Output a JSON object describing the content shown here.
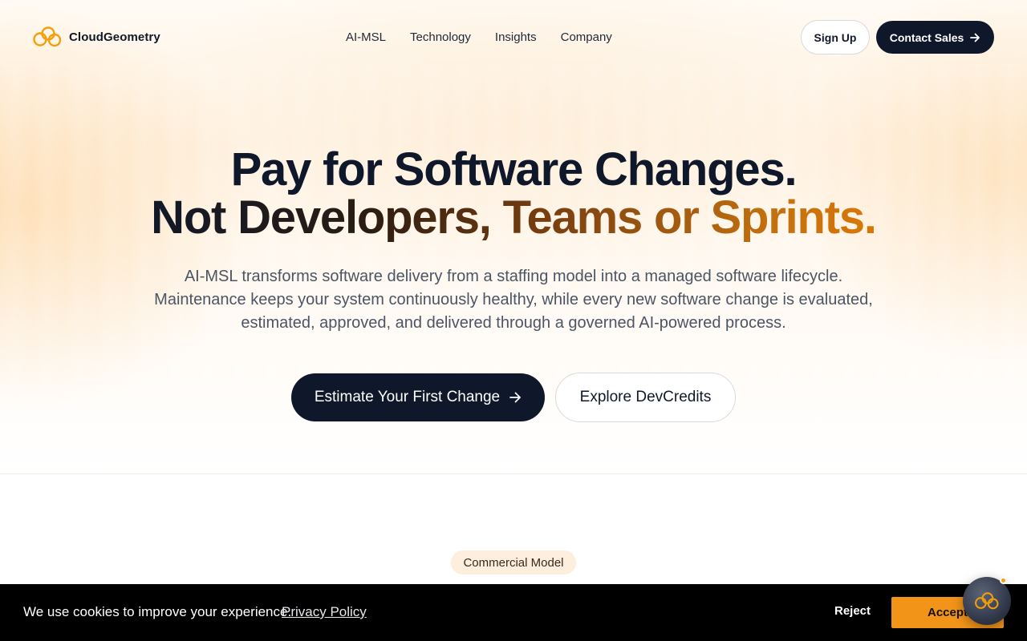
{
  "brand": {
    "name": "CloudGeometry",
    "icon": "cloud-link-icon",
    "accent_color": "#f59e0b",
    "dark_color": "#0f172a"
  },
  "nav": {
    "items": [
      {
        "label": "AI-MSL"
      },
      {
        "label": "Technology"
      },
      {
        "label": "Insights"
      },
      {
        "label": "Company"
      }
    ]
  },
  "header": {
    "signup_label": "Sign Up",
    "contact_label": "Contact Sales",
    "contact_icon": "arrow-right-icon"
  },
  "hero": {
    "title_line1": "Pay for Software Changes.",
    "title_line2": "Not Developers, Teams or Sprints.",
    "subtitle_line1": "AI-MSL transforms software delivery from a staffing model into a managed software lifecycle.",
    "subtitle_line2": "Maintenance keeps your system continuously healthy, while every new software change is evaluated,",
    "subtitle_line3": "estimated, approved, and delivered through a governed AI-powered process.",
    "primary_cta": "Estimate Your First Change",
    "primary_cta_icon": "arrow-right-icon",
    "secondary_cta": "Explore DevCredits"
  },
  "section": {
    "badge": "Commercial Model"
  },
  "cookie_banner": {
    "message": "We use cookies to improve your experience.",
    "link_label": "Privacy Policy",
    "reject_label": "Reject",
    "accept_label": "Accept",
    "accept_color": "#f29418"
  },
  "chat_widget": {
    "icon": "cloud-link-icon",
    "status_color": "#f59e0b"
  }
}
